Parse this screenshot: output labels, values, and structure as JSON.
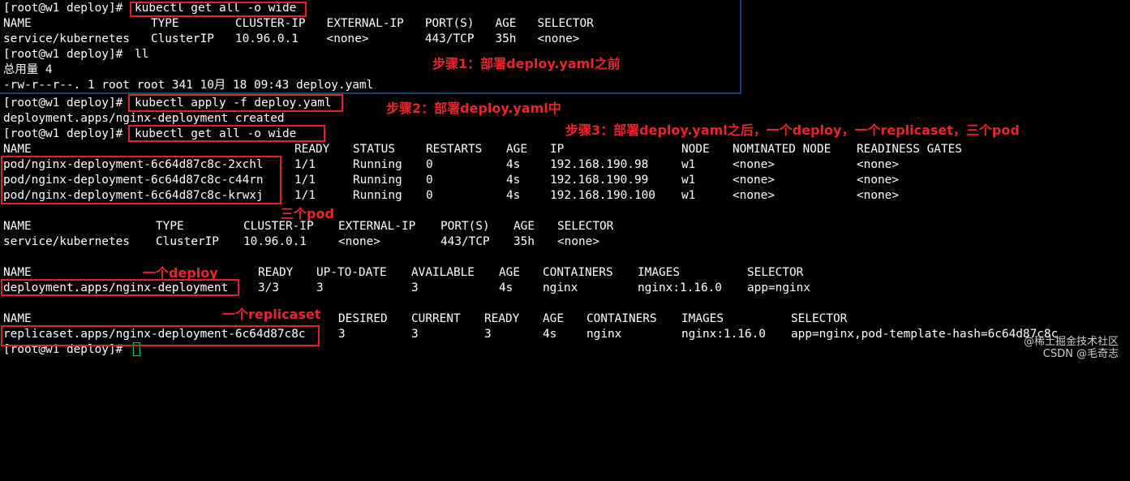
{
  "terminal": {
    "prompt": "[root@w1 deploy]# ",
    "step1_lines": {
      "cmd1": "kubectl get all -o wide",
      "header": "NAME                 TYPE        CLUSTER-IP   EXTERNAL-IP   PORT(S)   AGE   SELECTOR",
      "svc": "service/kubernetes   ClusterIP   10.96.0.1    <none>        443/TCP   35h   <none>",
      "cmd2": "ll",
      "total": "总用量 4",
      "file": "-rw-r--r--. 1 root root 341 10月 18 09:43 deploy.yaml"
    },
    "apply_cmd": "kubectl apply -f deploy.yaml",
    "apply_result": "deployment.apps/nginx-deployment created",
    "get_cmd": "kubectl get all -o wide",
    "pods": {
      "headers": [
        "NAME",
        "READY",
        "STATUS",
        "RESTARTS",
        "AGE",
        "IP",
        "NODE",
        "NOMINATED NODE",
        "READINESS GATES"
      ],
      "rows": [
        [
          "pod/nginx-deployment-6c64d87c8c-2xchl",
          "1/1",
          "Running",
          "0",
          "4s",
          "192.168.190.98",
          "w1",
          "<none>",
          "<none>"
        ],
        [
          "pod/nginx-deployment-6c64d87c8c-c44rn",
          "1/1",
          "Running",
          "0",
          "4s",
          "192.168.190.99",
          "w1",
          "<none>",
          "<none>"
        ],
        [
          "pod/nginx-deployment-6c64d87c8c-krwxj",
          "1/1",
          "Running",
          "0",
          "4s",
          "192.168.190.100",
          "w1",
          "<none>",
          "<none>"
        ]
      ]
    },
    "services": {
      "headers": [
        "NAME",
        "TYPE",
        "CLUSTER-IP",
        "EXTERNAL-IP",
        "PORT(S)",
        "AGE",
        "SELECTOR"
      ],
      "row": [
        "service/kubernetes",
        "ClusterIP",
        "10.96.0.1",
        "<none>",
        "443/TCP",
        "35h",
        "<none>"
      ]
    },
    "deployments": {
      "headers": [
        "NAME",
        "READY",
        "UP-TO-DATE",
        "AVAILABLE",
        "AGE",
        "CONTAINERS",
        "IMAGES",
        "SELECTOR"
      ],
      "row": [
        "deployment.apps/nginx-deployment",
        "3/3",
        "3",
        "3",
        "4s",
        "nginx",
        "nginx:1.16.0",
        "app=nginx"
      ]
    },
    "replicasets": {
      "headers": [
        "NAME",
        "DESIRED",
        "CURRENT",
        "READY",
        "AGE",
        "CONTAINERS",
        "IMAGES",
        "SELECTOR"
      ],
      "row": [
        "replicaset.apps/nginx-deployment-6c64d87c8c",
        "3",
        "3",
        "3",
        "4s",
        "nginx",
        "nginx:1.16.0",
        "app=nginx,pod-template-hash=6c64d87c8c"
      ]
    }
  },
  "annotations": {
    "step1": "步骤1：部署deploy.yaml之前",
    "step2": "步骤2：部署deploy.yaml中",
    "step3": "步骤3：部署deploy.yaml之后，一个deploy，一个replicaset，三个pod",
    "three_pods": "三个pod",
    "one_deploy": "一个deploy",
    "one_rs": "一个replicaset"
  },
  "watermark": {
    "site": "@稀土掘金技术社区",
    "author": "CSDN @毛奇志"
  },
  "colors": {
    "background": "#000000",
    "text": "#ffffff",
    "highlight_box": "#d9232d",
    "annotation": "#e8262b",
    "cursor": "#20c040"
  }
}
